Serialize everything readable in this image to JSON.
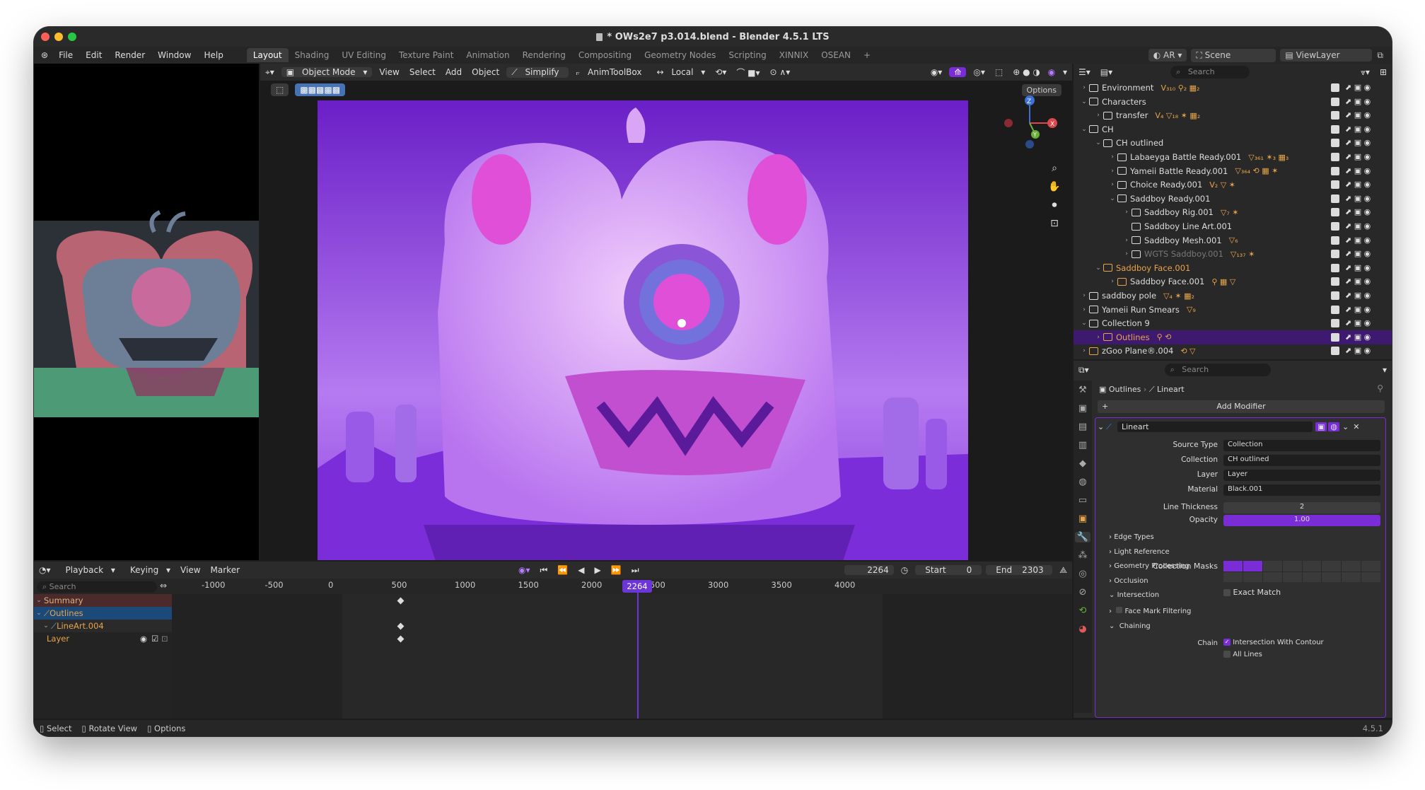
{
  "window": {
    "title": "* OWs2e7 p3.014.blend - Blender 4.5.1 LTS",
    "version": "4.5.1"
  },
  "menu": [
    "File",
    "Edit",
    "Render",
    "Window",
    "Help"
  ],
  "workspaces": [
    "Layout",
    "Shading",
    "UV Editing",
    "Texture Paint",
    "Animation",
    "Rendering",
    "Compositing",
    "Geometry Nodes",
    "Scripting",
    "XINNIX",
    "OSEAN"
  ],
  "topright": {
    "ar": "AR",
    "scene": "Scene",
    "viewlayer": "ViewLayer"
  },
  "viewport": {
    "mode": "Object Mode",
    "view": "View",
    "select": "Select",
    "add": "Add",
    "object": "Object",
    "simplify": "Simplify",
    "animtoolbox": "AnimToolBox",
    "transform": "Local",
    "options": "Options",
    "gizmo": {
      "x": "X",
      "y": "Y",
      "z": "Z"
    }
  },
  "outliner": {
    "search_placeholder": "Search",
    "rows": [
      {
        "label": "Environment",
        "indent": 0,
        "open": false,
        "icon": "collection",
        "color": "#dcdcdc",
        "extras": "ᐯ₃₁₀ ⚲₂ ▦₂"
      },
      {
        "label": "Characters",
        "indent": 0,
        "open": true,
        "icon": "collection",
        "color": "#dcdcdc",
        "extras": ""
      },
      {
        "label": "transfer",
        "indent": 1,
        "open": false,
        "icon": "collection",
        "color": "#dcdcdc",
        "extras": "ᐯ₄ ▽₁₈ ✶ ▦₂"
      },
      {
        "label": "CH",
        "indent": 0,
        "open": true,
        "icon": "collection",
        "color": "#dcdcdc",
        "extras": ""
      },
      {
        "label": "CH outlined",
        "indent": 1,
        "open": true,
        "icon": "collection",
        "color": "#dcdcdc",
        "extras": ""
      },
      {
        "label": "Labaeyga Battle Ready.001",
        "indent": 2,
        "open": false,
        "icon": "armature",
        "color": "#dcdcdc",
        "extras": "▽₃₆₁ ✶₃ ▦₃"
      },
      {
        "label": "Yameii Battle Ready.001",
        "indent": 2,
        "open": false,
        "icon": "armature",
        "color": "#dcdcdc",
        "extras": "▽₃₆₄ ⟲ ▦ ✶"
      },
      {
        "label": "Choice Ready.001",
        "indent": 2,
        "open": false,
        "icon": "collection",
        "color": "#dcdcdc",
        "extras": "ᐯ₂ ▽ ✶"
      },
      {
        "label": "Saddboy Ready.001",
        "indent": 2,
        "open": true,
        "icon": "armature",
        "color": "#dcdcdc",
        "extras": ""
      },
      {
        "label": "Saddboy Rig.001",
        "indent": 3,
        "open": false,
        "icon": "collection",
        "color": "#dcdcdc",
        "extras": "▽₇ ✶"
      },
      {
        "label": "Saddboy Line Art.001",
        "indent": 3,
        "open": null,
        "icon": "collection",
        "color": "#dcdcdc",
        "extras": ""
      },
      {
        "label": "Saddboy Mesh.001",
        "indent": 3,
        "open": false,
        "icon": "collection",
        "color": "#dcdcdc",
        "extras": "▽₆"
      },
      {
        "label": "WGTS Saddboy.001",
        "indent": 3,
        "open": false,
        "icon": "collection",
        "color": "#777",
        "extras": "▽₁₃₇ ✶"
      },
      {
        "label": "Saddboy Face.001",
        "indent": 1,
        "open": true,
        "icon": "collection",
        "color": "#e8a44a",
        "extras": ""
      },
      {
        "label": "Saddboy Face.001",
        "indent": 2,
        "open": false,
        "icon": "mesh",
        "color": "#dcdcdc",
        "extras": "⚲ ▦ ▽"
      },
      {
        "label": "saddboy pole",
        "indent": 0,
        "open": false,
        "icon": "collection",
        "color": "#dcdcdc",
        "extras": "▽₄ ✶ ▦₂"
      },
      {
        "label": "Yameii Run Smears",
        "indent": 0,
        "open": false,
        "icon": "collection",
        "color": "#dcdcdc",
        "extras": "▽₉"
      },
      {
        "label": "Collection 9",
        "indent": 0,
        "open": true,
        "icon": "collection",
        "color": "#dcdcdc",
        "extras": ""
      },
      {
        "label": "Outlines",
        "indent": 1,
        "open": false,
        "icon": "lineart",
        "color": "#e8a44a",
        "extras": "⚲ ⟲"
      },
      {
        "label": "zGoo Plane®.004",
        "indent": 0,
        "open": false,
        "icon": "mesh",
        "color": "#dcdcdc",
        "extras": "⟲ ▽"
      }
    ]
  },
  "properties": {
    "search_placeholder": "Search",
    "breadcrumb": [
      "Outlines",
      "Lineart"
    ],
    "add_modifier": "Add Modifier",
    "modifier_name": "Lineart",
    "fields": [
      {
        "label": "Source Type",
        "value": "Collection"
      },
      {
        "label": "Collection",
        "value": "CH outlined"
      },
      {
        "label": "Layer",
        "value": "Layer"
      },
      {
        "label": "Material",
        "value": "Black.001"
      },
      {
        "label": "Line Thickness",
        "value": "2"
      },
      {
        "label": "Opacity",
        "value": "1.00"
      }
    ],
    "sections": [
      "Edge Types",
      "Light Reference",
      "Geometry Processing",
      "Occlusion",
      "Intersection"
    ],
    "collection_masks": "Collection Masks",
    "exact_match": "Exact Match",
    "face_mark": "Face Mark Filtering",
    "chaining": "Chaining",
    "chain_label": "Chain",
    "chain_opt": "Intersection With Contour",
    "all_lines": "All Lines"
  },
  "timeline": {
    "menus": [
      "Playback",
      "Keying",
      "View",
      "Marker"
    ],
    "current": "2264",
    "start_label": "Start",
    "start": "0",
    "end_label": "End",
    "end": "2303",
    "ruler": [
      "-1000",
      "-500",
      "0",
      "500",
      "1000",
      "1500",
      "2000",
      "2500",
      "3000",
      "3500",
      "4000"
    ],
    "channels": [
      "Summary",
      "Outlines",
      "LineArt.004",
      "Layer"
    ],
    "search_placeholder": "Search"
  },
  "statusbar": {
    "select": "Select",
    "rotate": "Rotate View",
    "options": "Options",
    "version": "4.5.1"
  },
  "colors": {
    "accent": "#7a2cd6",
    "selection": "#3d1a70",
    "playhead": "#6b35d8"
  }
}
